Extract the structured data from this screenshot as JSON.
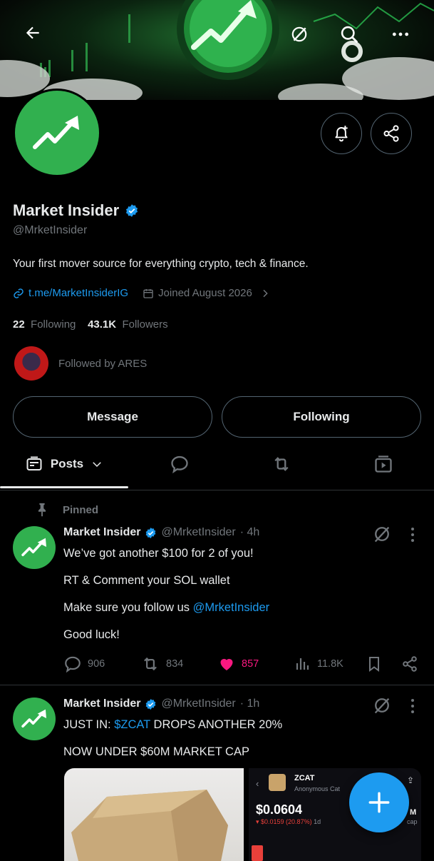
{
  "header": {
    "back_icon": "arrow-left-icon",
    "grok_icon": "grok-icon",
    "search_icon": "search-icon",
    "more_icon": "more-horizontal-icon"
  },
  "profile": {
    "name": "Market Insider",
    "handle": "@MrketInsider",
    "bio": "Your first mover source for everything crypto, tech & finance.",
    "link": "t.me/MarketInsiderIG",
    "joined": "Joined August 2026",
    "following_count": "22",
    "following_label": "Following",
    "followers_count": "43.1K",
    "followers_label": "Followers",
    "followed_by": "Followed by ARES"
  },
  "buttons": {
    "message": "Message",
    "following": "Following"
  },
  "tabs": {
    "posts": "Posts"
  },
  "posts": [
    {
      "pinned_label": "Pinned",
      "name": "Market Insider",
      "handle": "@MrketInsider",
      "time": "· 4h",
      "lines": [
        "We’ve got another $100 for 2 of you!",
        "RT & Comment your SOL wallet",
        "Make sure you follow us ",
        "Good luck!"
      ],
      "mention": "@MrketInsider",
      "replies": "906",
      "reposts": "834",
      "likes": "857",
      "views": "11.8K"
    },
    {
      "name": "Market Insider",
      "handle": "@MrketInsider",
      "time": "· 1h",
      "prefix": "JUST IN: ",
      "cashtag": "$ZCAT",
      "suffix": " DROPS ANOTHER 20%",
      "line2": "NOW UNDER $60M MARKET CAP"
    }
  ],
  "media": {
    "token_name": "ZCAT",
    "token_sub": "Anonymous Cat",
    "price": "$0.0604",
    "change": "▾ $0.0159 (20.87%)",
    "change_period": "1d",
    "mcap_partial": "M",
    "cap_partial": "cap"
  },
  "colors": {
    "accent": "#1d9bf0",
    "brand_green": "#31b04f",
    "like_pink": "#f91880",
    "muted": "#71767b"
  }
}
